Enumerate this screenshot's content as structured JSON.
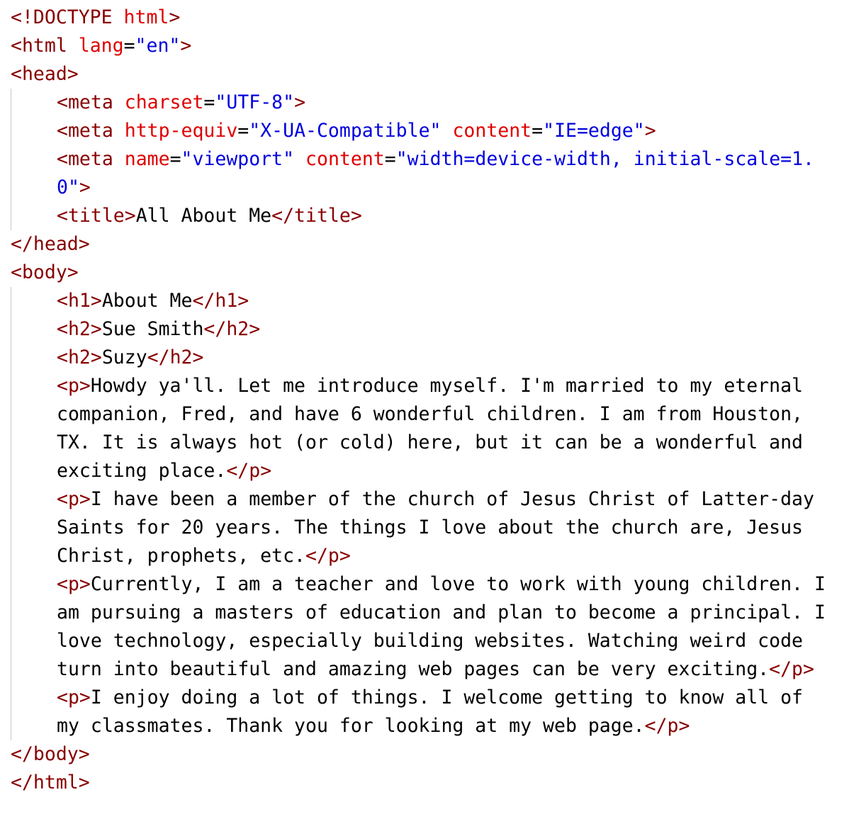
{
  "document": {
    "lines": [
      [
        {
          "c": "t",
          "s": "<!DOCTYPE "
        },
        {
          "c": "a",
          "s": "html"
        },
        {
          "c": "t",
          "s": ">"
        }
      ],
      [
        {
          "c": "t",
          "s": "<html "
        },
        {
          "c": "a",
          "s": "lang"
        },
        {
          "c": "x",
          "s": "="
        },
        {
          "c": "v",
          "s": "\"en\""
        },
        {
          "c": "t",
          "s": ">"
        }
      ],
      [
        {
          "c": "t",
          "s": "<head>"
        }
      ],
      [
        {
          "c": "t",
          "s": "<meta "
        },
        {
          "c": "a",
          "s": "charset"
        },
        {
          "c": "x",
          "s": "="
        },
        {
          "c": "v",
          "s": "\"UTF-8\""
        },
        {
          "c": "t",
          "s": ">"
        }
      ],
      [
        {
          "c": "t",
          "s": "<meta "
        },
        {
          "c": "a",
          "s": "http-equiv"
        },
        {
          "c": "x",
          "s": "="
        },
        {
          "c": "v",
          "s": "\"X-UA-Compatible\""
        },
        {
          "c": "x",
          "s": " "
        },
        {
          "c": "a",
          "s": "content"
        },
        {
          "c": "x",
          "s": "="
        },
        {
          "c": "v",
          "s": "\"IE=edge\""
        },
        {
          "c": "t",
          "s": ">"
        }
      ],
      [
        {
          "c": "t",
          "s": "<meta "
        },
        {
          "c": "a",
          "s": "name"
        },
        {
          "c": "x",
          "s": "="
        },
        {
          "c": "v",
          "s": "\"viewport\""
        },
        {
          "c": "x",
          "s": " "
        },
        {
          "c": "a",
          "s": "content"
        },
        {
          "c": "x",
          "s": "="
        },
        {
          "c": "v",
          "s": "\"width=device-width, initial-scale=1."
        }
      ],
      [
        {
          "c": "v",
          "s": "0\""
        },
        {
          "c": "t",
          "s": ">"
        }
      ],
      [
        {
          "c": "t",
          "s": "<title>"
        },
        {
          "c": "x",
          "s": "All About Me"
        },
        {
          "c": "t",
          "s": "</title>"
        }
      ],
      [
        {
          "c": "t",
          "s": "</head>"
        }
      ],
      [
        {
          "c": "t",
          "s": "<body>"
        }
      ],
      [
        {
          "c": "t",
          "s": "<h1>"
        },
        {
          "c": "x",
          "s": "About Me"
        },
        {
          "c": "t",
          "s": "</h1>"
        }
      ],
      [
        {
          "c": "t",
          "s": "<h2>"
        },
        {
          "c": "x",
          "s": "Sue Smith"
        },
        {
          "c": "t",
          "s": "</h2>"
        }
      ],
      [
        {
          "c": "t",
          "s": "<h2>"
        },
        {
          "c": "x",
          "s": "Suzy"
        },
        {
          "c": "t",
          "s": "</h2>"
        }
      ],
      [
        {
          "c": "t",
          "s": "<p>"
        },
        {
          "c": "x",
          "s": "Howdy ya'll. Let me introduce myself. I'm married to my eternal"
        }
      ],
      [
        {
          "c": "x",
          "s": "companion, Fred, and have 6 wonderful children. I am from Houston,"
        }
      ],
      [
        {
          "c": "x",
          "s": "TX. It is always hot (or cold) here, but it can be a wonderful and"
        }
      ],
      [
        {
          "c": "x",
          "s": "exciting place."
        },
        {
          "c": "t",
          "s": "</p>"
        }
      ],
      [
        {
          "c": "t",
          "s": "<p>"
        },
        {
          "c": "x",
          "s": "I have been a member of the church of Jesus Christ of Latter-day"
        }
      ],
      [
        {
          "c": "x",
          "s": "Saints for 20 years. The things I love about the church are, Jesus"
        }
      ],
      [
        {
          "c": "x",
          "s": "Christ, prophets, etc."
        },
        {
          "c": "t",
          "s": "</p>"
        }
      ],
      [
        {
          "c": "t",
          "s": "<p>"
        },
        {
          "c": "x",
          "s": "Currently, I am a teacher and love to work with young children. I"
        }
      ],
      [
        {
          "c": "x",
          "s": "am pursuing a masters of education and plan to become a principal. I"
        }
      ],
      [
        {
          "c": "x",
          "s": "love technology, especially building websites. Watching weird code"
        }
      ],
      [
        {
          "c": "x",
          "s": "turn into beautiful and amazing web pages can be very exciting."
        },
        {
          "c": "t",
          "s": "</p>"
        }
      ],
      [
        {
          "c": "t",
          "s": "<p>"
        },
        {
          "c": "x",
          "s": "I enjoy doing a lot of things. I welcome getting to know all of"
        }
      ],
      [
        {
          "c": "x",
          "s": "my classmates. Thank you for looking at my web page."
        },
        {
          "c": "t",
          "s": "</p>"
        }
      ],
      [
        {
          "c": "t",
          "s": "</body>"
        }
      ],
      [
        {
          "c": "t",
          "s": "</html>"
        }
      ]
    ]
  },
  "colors": {
    "tag": "#880000",
    "attribute": "#e00000",
    "value": "#0000dd",
    "text": "#000000",
    "indent_guide": "#c8c8c8"
  }
}
